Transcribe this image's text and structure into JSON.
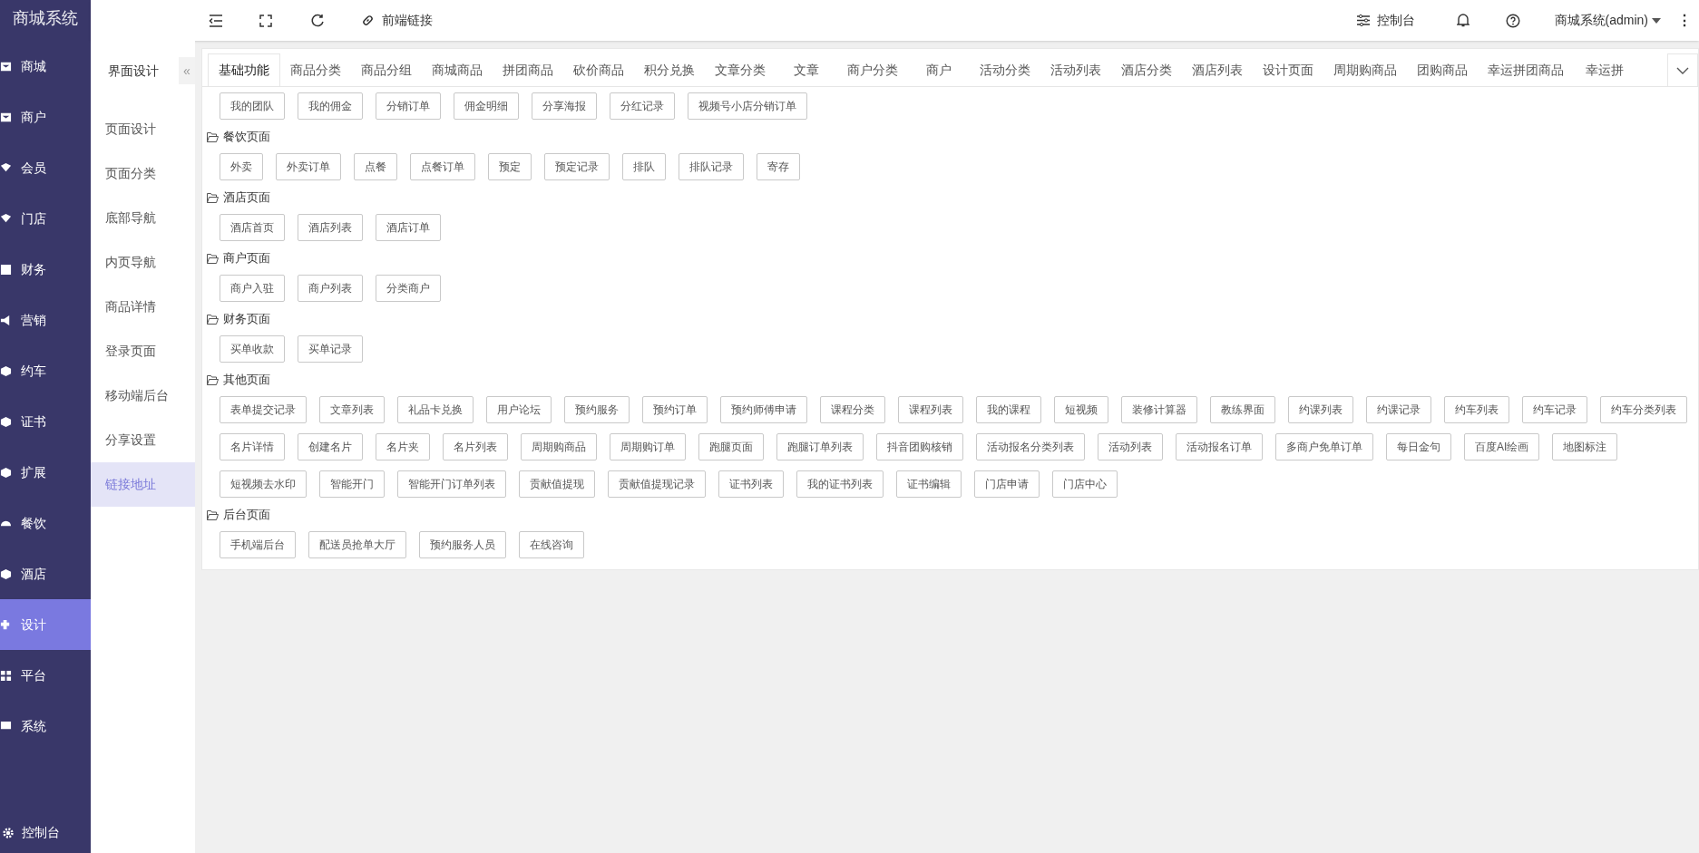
{
  "brand": "商城系统",
  "header": {
    "link_label": "前端链接",
    "console_label": "控制台",
    "user_label": "商城系统(admin)",
    "more": "⋮"
  },
  "sidebar": {
    "items": [
      {
        "label": "商城",
        "selected": false
      },
      {
        "label": "商户",
        "selected": false
      },
      {
        "label": "会员",
        "selected": false
      },
      {
        "label": "门店",
        "selected": false
      },
      {
        "label": "财务",
        "selected": false
      },
      {
        "label": "营销",
        "selected": false
      },
      {
        "label": "约车",
        "selected": false
      },
      {
        "label": "证书",
        "selected": false
      },
      {
        "label": "扩展",
        "selected": false
      },
      {
        "label": "餐饮",
        "selected": false
      },
      {
        "label": "酒店",
        "selected": false
      },
      {
        "label": "设计",
        "selected": true
      },
      {
        "label": "平台",
        "selected": false
      },
      {
        "label": "系统",
        "selected": false
      }
    ],
    "bottom": "控制台"
  },
  "submenu": {
    "title": "界面设计",
    "collapse": "«",
    "items": [
      {
        "label": "页面设计",
        "selected": false
      },
      {
        "label": "页面分类",
        "selected": false
      },
      {
        "label": "底部导航",
        "selected": false
      },
      {
        "label": "内页导航",
        "selected": false
      },
      {
        "label": "商品详情",
        "selected": false
      },
      {
        "label": "登录页面",
        "selected": false
      },
      {
        "label": "移动端后台",
        "selected": false
      },
      {
        "label": "分享设置",
        "selected": false
      },
      {
        "label": "链接地址",
        "selected": true
      }
    ]
  },
  "tabs": [
    {
      "label": "基础功能",
      "selected": true
    },
    {
      "label": "商品分类",
      "selected": false
    },
    {
      "label": "商品分组",
      "selected": false
    },
    {
      "label": "商城商品",
      "selected": false
    },
    {
      "label": "拼团商品",
      "selected": false
    },
    {
      "label": "砍价商品",
      "selected": false
    },
    {
      "label": "积分兑换",
      "selected": false
    },
    {
      "label": "文章分类",
      "selected": false
    },
    {
      "label": "文章",
      "selected": false
    },
    {
      "label": "商户分类",
      "selected": false
    },
    {
      "label": "商户",
      "selected": false
    },
    {
      "label": "活动分类",
      "selected": false
    },
    {
      "label": "活动列表",
      "selected": false
    },
    {
      "label": "酒店分类",
      "selected": false
    },
    {
      "label": "酒店列表",
      "selected": false
    },
    {
      "label": "设计页面",
      "selected": false
    },
    {
      "label": "周期购商品",
      "selected": false
    },
    {
      "label": "团购商品",
      "selected": false
    },
    {
      "label": "幸运拼团商品",
      "selected": false
    },
    {
      "label": "幸运拼",
      "selected": false
    }
  ],
  "sections": [
    {
      "links": [
        "我的团队",
        "我的佣金",
        "分销订单",
        "佣金明细",
        "分享海报",
        "分红记录",
        "视频号小店分销订单"
      ]
    },
    {
      "title": "餐饮页面",
      "links": [
        "外卖",
        "外卖订单",
        "点餐",
        "点餐订单",
        "预定",
        "预定记录",
        "排队",
        "排队记录",
        "寄存"
      ]
    },
    {
      "title": "酒店页面",
      "links": [
        "酒店首页",
        "酒店列表",
        "酒店订单"
      ]
    },
    {
      "title": "商户页面",
      "links": [
        "商户入驻",
        "商户列表",
        "分类商户"
      ]
    },
    {
      "title": "财务页面",
      "links": [
        "买单收款",
        "买单记录"
      ]
    },
    {
      "title": "其他页面",
      "links": [
        "表单提交记录",
        "文章列表",
        "礼品卡兑换",
        "用户论坛",
        "预约服务",
        "预约订单",
        "预约师傅申请",
        "课程分类",
        "课程列表",
        "我的课程",
        "短视频",
        "装修计算器",
        "教练界面",
        "约课列表",
        "约课记录",
        "约车列表",
        "约车记录",
        "约车分类列表",
        "名片详情",
        "创建名片",
        "名片夹",
        "名片列表",
        "周期购商品",
        "周期购订单",
        "跑腿页面",
        "跑腿订单列表",
        "抖音团购核销",
        "活动报名分类列表",
        "活动列表",
        "活动报名订单",
        "多商户免单订单",
        "每日金句",
        "百度AI绘画",
        "地图标注",
        "短视频去水印",
        "智能开门",
        "智能开门订单列表",
        "贡献值提现",
        "贡献值提现记录",
        "证书列表",
        "我的证书列表",
        "证书编辑",
        "门店申请",
        "门店中心"
      ]
    },
    {
      "title": "后台页面",
      "links": [
        "手机端后台",
        "配送员抢单大厅",
        "预约服务人员",
        "在线咨询"
      ]
    }
  ]
}
